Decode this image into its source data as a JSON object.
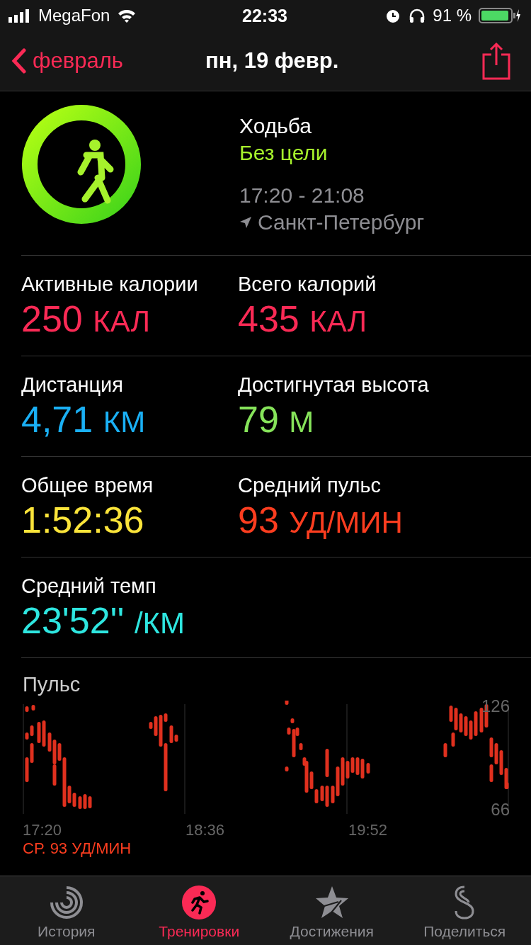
{
  "status_bar": {
    "carrier": "MegaFon",
    "time": "22:33",
    "battery": "91 %"
  },
  "nav": {
    "back": "февраль",
    "title": "пн, 19 февр."
  },
  "workout": {
    "name": "Ходьба",
    "goal": "Без цели",
    "time_range": "17:20 - 21:08",
    "location": "Санкт-Петербург"
  },
  "stats": [
    [
      {
        "label": "Активные калории",
        "value": "250",
        "unit": "КАЛ",
        "color": "#fa2a55"
      },
      {
        "label": "Всего калорий",
        "value": "435",
        "unit": "КАЛ",
        "color": "#fa2a55"
      }
    ],
    [
      {
        "label": "Дистанция",
        "value": "4,71",
        "unit": "КМ",
        "color": "#1ab0f5"
      },
      {
        "label": "Достигнутая высота",
        "value": "79",
        "unit": "М",
        "color": "#86e35a"
      }
    ],
    [
      {
        "label": "Общее время",
        "value": "1:52:36",
        "color": "#fbe43a"
      },
      {
        "label": "Средний пульс",
        "value": "93",
        "unit": "УД/МИН",
        "color": "#fc3d1f"
      }
    ],
    [
      {
        "label": "Средний темп",
        "value": "23'52''",
        "unit": "/КМ",
        "color": "#2ee6e0"
      }
    ]
  ],
  "heart_rate": {
    "title": "Пульс",
    "y_max": "126",
    "y_min": "66",
    "x_labels": [
      "17:20",
      "18:36",
      "19:52"
    ],
    "average": "СР. 93 УД/МИН"
  },
  "tabs": [
    {
      "label": "История",
      "kind": "rings",
      "selected": false
    },
    {
      "label": "Тренировки",
      "kind": "runner",
      "selected": true
    },
    {
      "label": "Достижения",
      "kind": "star",
      "selected": false
    },
    {
      "label": "Поделиться",
      "kind": "share",
      "selected": false
    }
  ]
}
